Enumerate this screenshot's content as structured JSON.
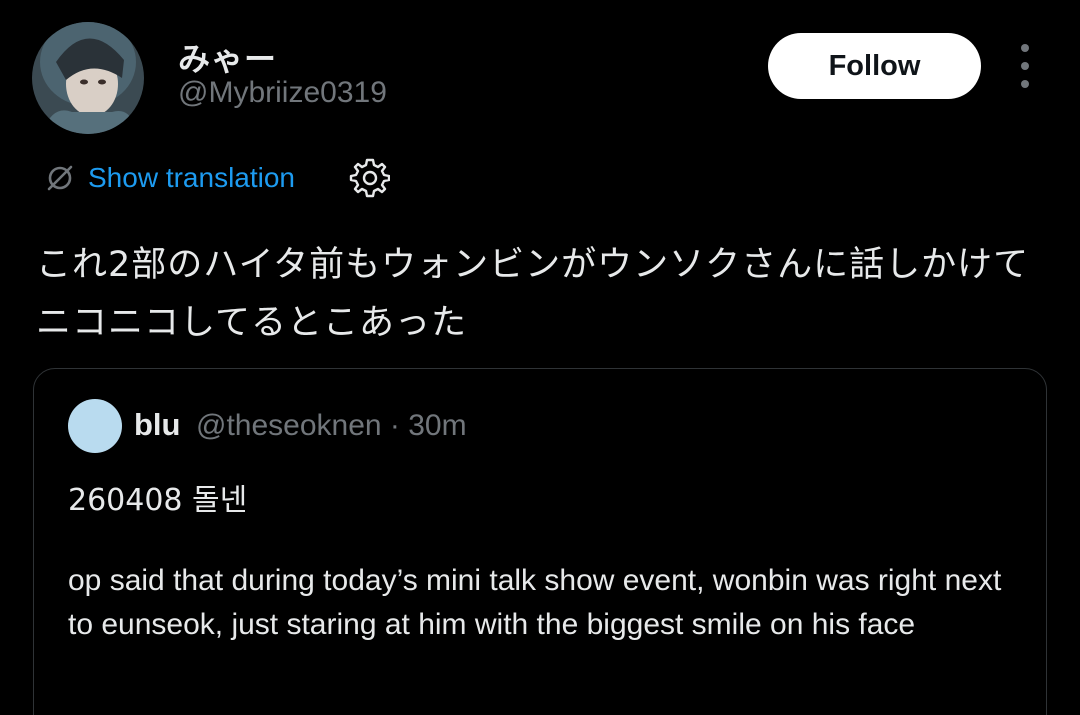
{
  "author": {
    "display_name": "みゃー",
    "handle": "@Mybriize0319"
  },
  "actions": {
    "follow_label": "Follow"
  },
  "translation": {
    "link_label": "Show translation"
  },
  "tweet": {
    "text": "これ2部のハイタ前もウォンビンがウンソクさんに話しかけてニコニコしてるとこあった"
  },
  "quote": {
    "name": "blu",
    "handle_time": "@theseoknen · 30m",
    "line1": "260408 돌넨",
    "body": "op said that during today’s mini talk show event, wonbin was right next to eunseok, just staring at him with the biggest smile on his face"
  },
  "colors": {
    "background": "#000000",
    "text_primary": "#e7e9ea",
    "text_secondary": "#71767b",
    "link": "#1d9bf0",
    "follow_bg": "#ffffff",
    "quote_avatar": "#b9dbef"
  }
}
